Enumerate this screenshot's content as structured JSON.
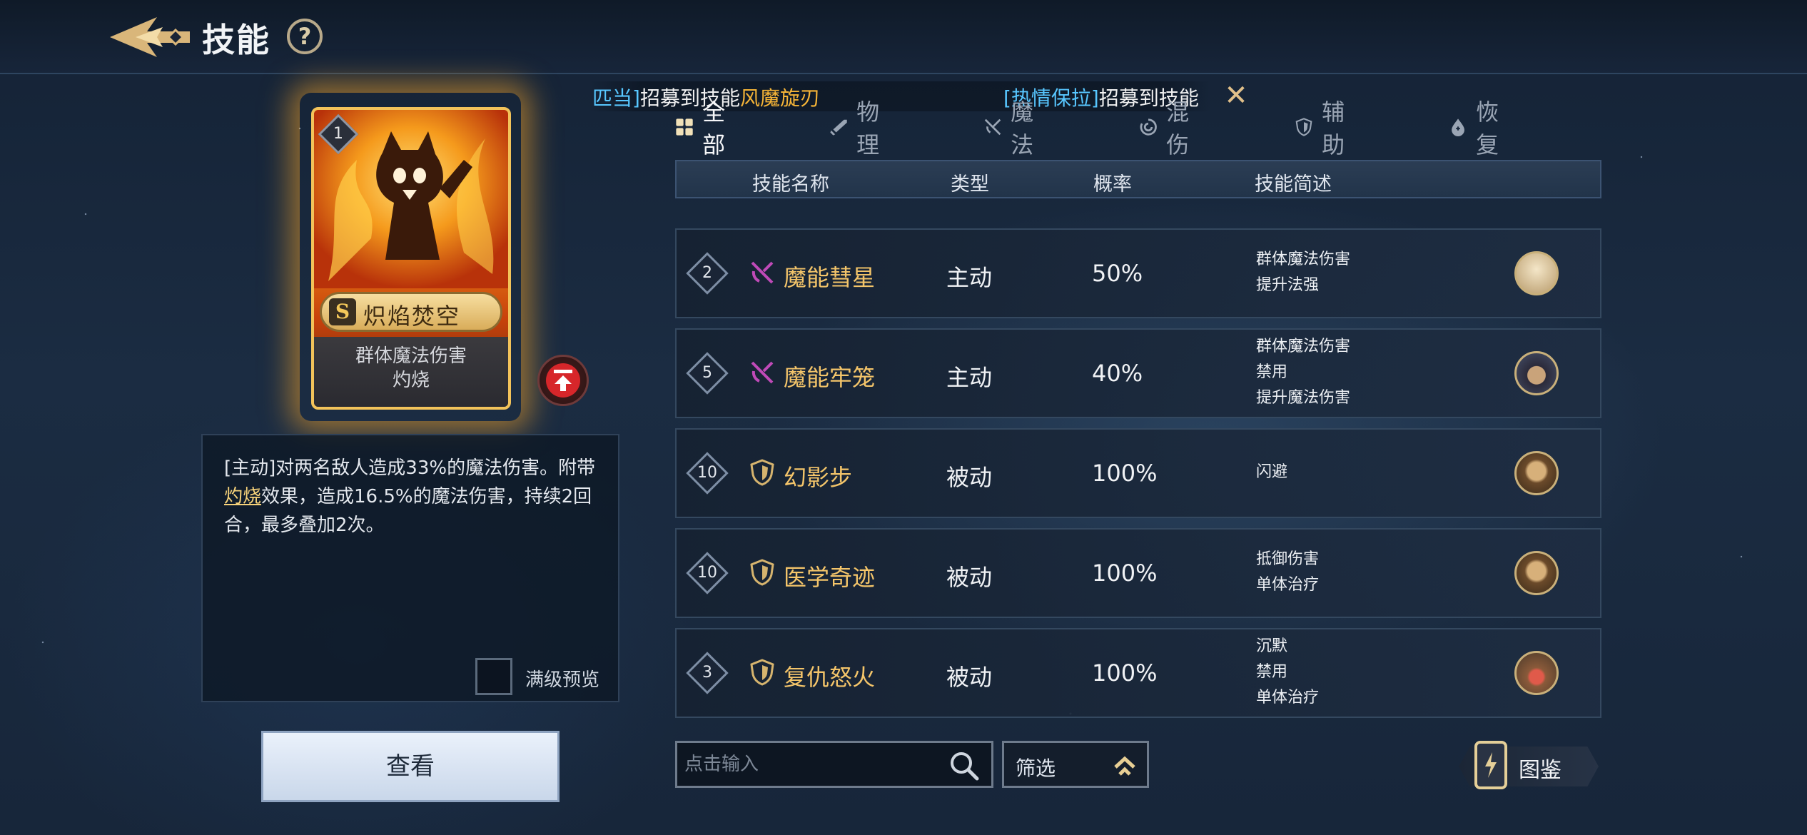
{
  "header": {
    "title": "技能",
    "help_label": "?"
  },
  "marquee": {
    "item1": {
      "name": "匹当]",
      "text": "招募到技能",
      "skill": "风魔旋刃"
    },
    "item2": {
      "name": "[热情保拉]",
      "text": "招募到技能"
    }
  },
  "card": {
    "level": "1",
    "rarity": "S",
    "name": "炽焰焚空",
    "desc_lines": [
      "群体魔法伤害",
      "灼烧"
    ]
  },
  "description": {
    "part1": "[主动]对两名敌人造成33%的魔法伤害。附带",
    "link": "灼烧",
    "part2": "效果，造成16.5%的魔法伤害，持续2回合，最多叠加2次。"
  },
  "max_preview": {
    "label": "满级预览",
    "checked": false
  },
  "view_button": "查看",
  "tabs": [
    {
      "label": "全部",
      "active": true,
      "icon": "grid-icon"
    },
    {
      "label": "物理",
      "active": false,
      "icon": "sword-icon"
    },
    {
      "label": "魔法",
      "active": false,
      "icon": "magic-swords-icon"
    },
    {
      "label": "混伤",
      "active": false,
      "icon": "swirl-icon"
    },
    {
      "label": "辅助",
      "active": false,
      "icon": "shield-icon"
    },
    {
      "label": "恢复",
      "active": false,
      "icon": "drop-icon"
    }
  ],
  "table": {
    "headers": {
      "name": "技能名称",
      "type": "类型",
      "rate": "概率",
      "desc": "技能简述"
    },
    "rows": [
      {
        "level": "2",
        "icon": "magic-swords-icon",
        "name": "魔能彗星",
        "type": "主动",
        "rate": "50%",
        "desc": [
          "群体魔法伤害",
          "提升法强"
        ]
      },
      {
        "level": "5",
        "icon": "magic-swords-icon",
        "name": "魔能牢笼",
        "type": "主动",
        "rate": "40%",
        "desc": [
          "群体魔法伤害",
          "禁用",
          "提升魔法伤害"
        ]
      },
      {
        "level": "10",
        "icon": "shield-icon",
        "name": "幻影步",
        "type": "被动",
        "rate": "100%",
        "desc": [
          "闪避"
        ]
      },
      {
        "level": "10",
        "icon": "shield-icon",
        "name": "医学奇迹",
        "type": "被动",
        "rate": "100%",
        "desc": [
          "抵御伤害",
          "单体治疗"
        ]
      },
      {
        "level": "3",
        "icon": "shield-icon",
        "name": "复仇怒火",
        "type": "被动",
        "rate": "100%",
        "desc": [
          "沉默",
          "禁用",
          "单体治疗"
        ]
      }
    ]
  },
  "search": {
    "placeholder": "点击输入"
  },
  "filter": {
    "label": "筛选"
  },
  "codex": {
    "label": "图鉴"
  },
  "colors": {
    "gold": "#f4c56a",
    "magic": "#c04ab8",
    "highlight": "#58c7ff",
    "skill_gold": "#f5b437"
  }
}
